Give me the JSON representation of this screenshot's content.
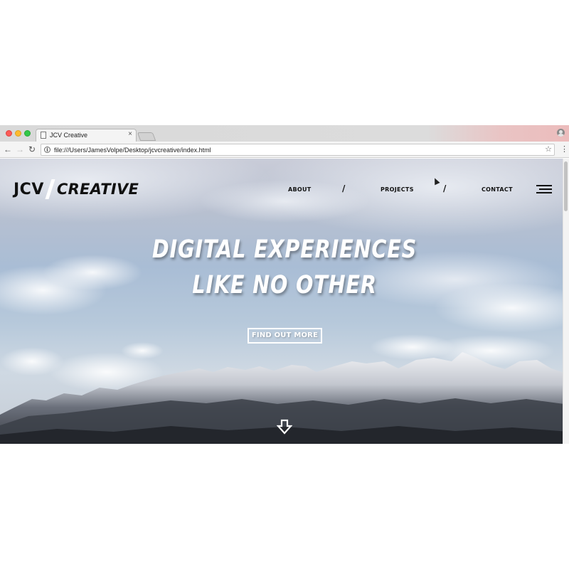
{
  "browser": {
    "tab_title": "JCV Creative",
    "tab_close": "×",
    "url": "file:///Users/JamesVolpe/Desktop/jcvcreative/index.html",
    "icons": {
      "back": "arrow-left",
      "forward": "arrow-right",
      "reload": "reload",
      "info": "info",
      "star": "star",
      "menu": "vertical-dots",
      "profile": "user"
    },
    "glyphs": {
      "back": "←",
      "forward": "→",
      "reload": "↻",
      "info": "i",
      "star": "☆",
      "menu": "⋮"
    }
  },
  "site": {
    "logo": {
      "part1": "JCV",
      "part2": "CREATIVE"
    },
    "nav": {
      "about": "ABOUT",
      "separator": "/",
      "projects": "PROJECTS",
      "contact": "CONTACT"
    },
    "hero": {
      "line1": "DIGITAL EXPERIENCES",
      "line2": "LIKE NO OTHER",
      "cta": "FIND OUT MORE"
    }
  },
  "colors": {
    "text_dark": "#111111",
    "hero_text": "#ffffff",
    "sky_light": "#c9ccd8",
    "sky_blue": "#a9bdd5",
    "mountain_dark": "#2a2d33"
  }
}
